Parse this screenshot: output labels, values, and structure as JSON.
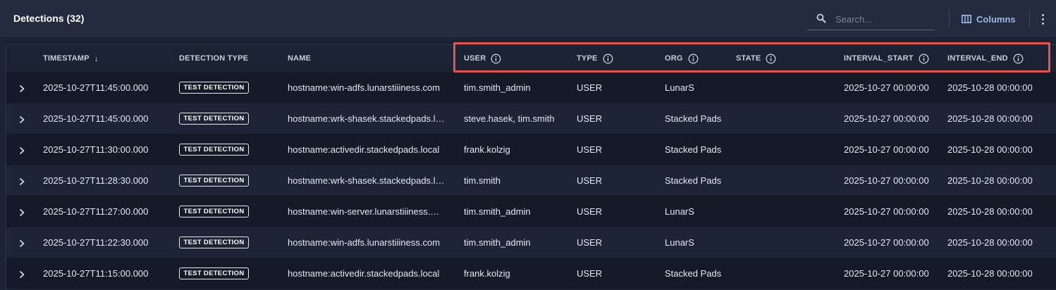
{
  "header": {
    "title": "Detections (32)",
    "search_placeholder": "Search...",
    "columns_label": "Columns"
  },
  "columns": {
    "timestamp": "TIMESTAMP",
    "detection_type": "DETECTION TYPE",
    "name": "NAME",
    "user": "USER",
    "type": "TYPE",
    "org": "ORG",
    "state": "STATE",
    "interval_start": "INTERVAL_START",
    "interval_end": "INTERVAL_END",
    "sort_indicator": "↓"
  },
  "rows": [
    {
      "timestamp": "2025-10-27T11:45:00.000",
      "detection_type": "TEST DETECTION",
      "name": "hostname:win-adfs.lunarstiiiness.com",
      "user": "tim.smith_admin",
      "type": "USER",
      "org": "LunarS",
      "state": "",
      "interval_start": "2025-10-27 00:00:00",
      "interval_end": "2025-10-28 00:00:00"
    },
    {
      "timestamp": "2025-10-27T11:45:00.000",
      "detection_type": "TEST DETECTION",
      "name": "hostname:wrk-shasek.stackedpads.l…",
      "user": "steve.hasek, tim.smith",
      "type": "USER",
      "org": "Stacked Pads",
      "state": "",
      "interval_start": "2025-10-27 00:00:00",
      "interval_end": "2025-10-28 00:00:00"
    },
    {
      "timestamp": "2025-10-27T11:30:00.000",
      "detection_type": "TEST DETECTION",
      "name": "hostname:activedir.stackedpads.local",
      "user": "frank.kolzig",
      "type": "USER",
      "org": "Stacked Pads",
      "state": "",
      "interval_start": "2025-10-27 00:00:00",
      "interval_end": "2025-10-28 00:00:00"
    },
    {
      "timestamp": "2025-10-27T11:28:30.000",
      "detection_type": "TEST DETECTION",
      "name": "hostname:wrk-shasek.stackedpads.l…",
      "user": "tim.smith",
      "type": "USER",
      "org": "Stacked Pads",
      "state": "",
      "interval_start": "2025-10-27 00:00:00",
      "interval_end": "2025-10-28 00:00:00"
    },
    {
      "timestamp": "2025-10-27T11:27:00.000",
      "detection_type": "TEST DETECTION",
      "name": "hostname:win-server.lunarstiiiness.…",
      "user": "tim.smith_admin",
      "type": "USER",
      "org": "LunarS",
      "state": "",
      "interval_start": "2025-10-27 00:00:00",
      "interval_end": "2025-10-28 00:00:00"
    },
    {
      "timestamp": "2025-10-27T11:22:30.000",
      "detection_type": "TEST DETECTION",
      "name": "hostname:win-adfs.lunarstiiiness.com",
      "user": "tim.smith_admin",
      "type": "USER",
      "org": "LunarS",
      "state": "",
      "interval_start": "2025-10-27 00:00:00",
      "interval_end": "2025-10-28 00:00:00"
    },
    {
      "timestamp": "2025-10-27T11:15:00.000",
      "detection_type": "TEST DETECTION",
      "name": "hostname:activedir.stackedpads.local",
      "user": "frank.kolzig",
      "type": "USER",
      "org": "Stacked Pads",
      "state": "",
      "interval_start": "2025-10-27 00:00:00",
      "interval_end": "2025-10-28 00:00:00"
    }
  ],
  "colors": {
    "highlight": "#e5534b",
    "background": "#1b2232",
    "header_bar": "#232c3e",
    "accent": "#9fb6e6"
  },
  "icons": [
    "search-icon",
    "columns-icon",
    "more-vertical-icon",
    "info-icon",
    "chevron-right-icon",
    "sort-down-icon"
  ]
}
